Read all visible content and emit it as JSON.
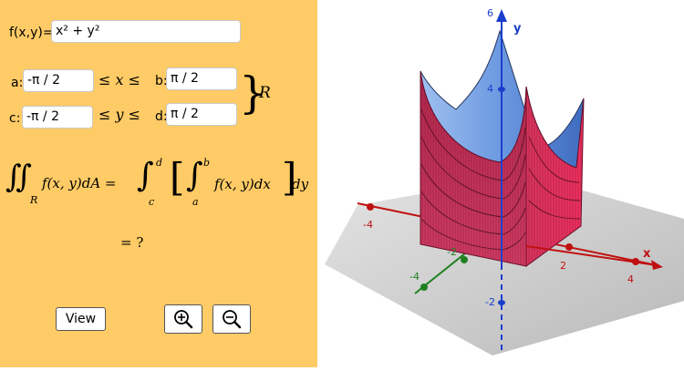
{
  "function": {
    "label": "f(x,y)=",
    "value": "x² + y²"
  },
  "bounds": {
    "a_label": "a:",
    "a_value": "-π / 2",
    "b_label": "b:",
    "b_value": "π / 2",
    "c_label": "c:",
    "c_value": "-π / 2",
    "d_label": "d:",
    "d_value": "π / 2",
    "x_relation": "≤ x ≤",
    "y_relation": "≤ y ≤",
    "region": "R"
  },
  "formula": {
    "double_integral": "∬",
    "sub_R": "R",
    "left": "f(x, y)dA =",
    "outer_int": "∫",
    "upper_d": "d",
    "lower_c": "c",
    "inner_int": "∫",
    "upper_b": "b",
    "lower_a": "a",
    "inner": "f(x, y)dx",
    "dy": "dy",
    "result": "= ?"
  },
  "buttons": {
    "view_label": "View",
    "zoom_in": "zoom-in-icon",
    "zoom_out": "zoom-out-icon"
  },
  "axes": {
    "x_label": "x",
    "y_label": "y",
    "ticks": {
      "z_top": "6",
      "z_mid": "4",
      "y_neg": "-2",
      "x_neg": "-4",
      "y_neg2": "-2",
      "y_neg4": "-4",
      "x_pos2": "2",
      "x_pos4": "4"
    }
  },
  "colors": {
    "panel": "#ffcb66",
    "surface_top": "#5f8fd9",
    "surface_side": "#b8264e",
    "x_axis": "#c01010",
    "y_axis": "#208020",
    "z_axis": "#1a3fcc"
  }
}
